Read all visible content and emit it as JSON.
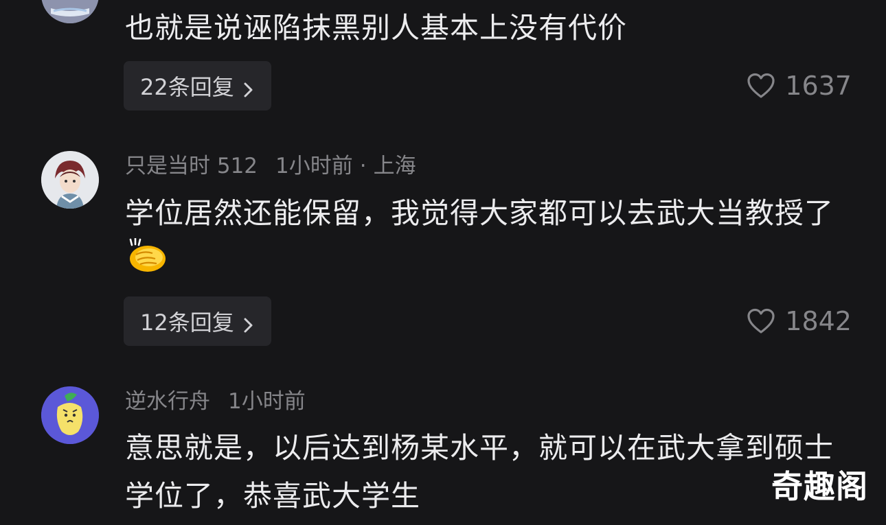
{
  "comments": [
    {
      "text": "也就是说诬陷抹黑别人基本上没有代价",
      "reply_label": "22条回复",
      "likes": "1637"
    },
    {
      "username": "只是当时 512",
      "time": "1小时前",
      "separator": "·",
      "location": "上海",
      "text": "学位居然还能保留，我觉得大家都可以去武大当教授了",
      "emoji": "clapping-hands-emoji",
      "reply_label": "12条回复",
      "likes": "1842"
    },
    {
      "username": "逆水行舟",
      "time": "1小时前",
      "text": "意思就是，以后达到杨某水平，就可以在武大拿到硕士学位了，恭喜武大学生"
    }
  ],
  "watermark": "奇趣阁",
  "colors": {
    "background": "#161618",
    "text_primary": "#ececee",
    "text_secondary": "#86868a",
    "reply_button_bg": "#26262a"
  }
}
